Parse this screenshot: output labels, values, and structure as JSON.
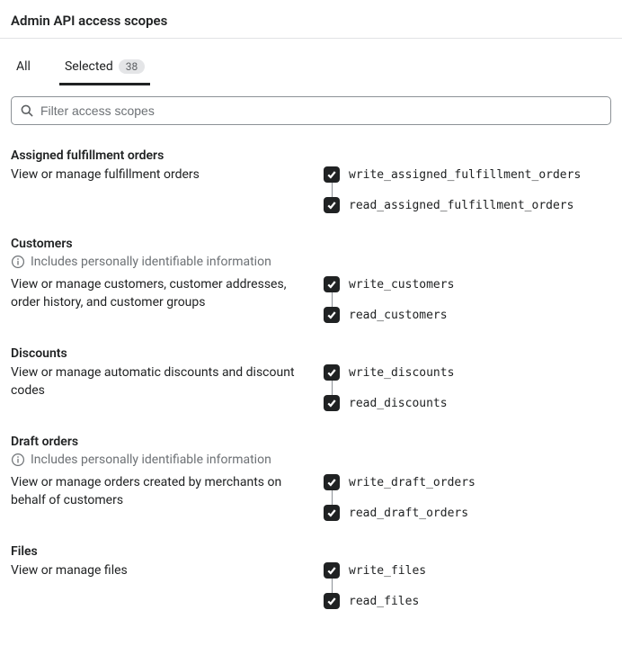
{
  "header": {
    "title": "Admin API access scopes"
  },
  "tabs": [
    {
      "label": "All",
      "active": false
    },
    {
      "label": "Selected",
      "active": true,
      "badge": "38"
    }
  ],
  "search": {
    "placeholder": "Filter access scopes"
  },
  "pii_text": "Includes personally identifiable information",
  "sections": [
    {
      "title": "Assigned fulfillment orders",
      "pii": false,
      "desc": "View or manage fulfillment orders",
      "scopes": [
        {
          "name": "write_assigned_fulfillment_orders",
          "checked": true
        },
        {
          "name": "read_assigned_fulfillment_orders",
          "checked": true
        }
      ]
    },
    {
      "title": "Customers",
      "pii": true,
      "desc": "View or manage customers, customer addresses, order history, and customer groups",
      "scopes": [
        {
          "name": "write_customers",
          "checked": true
        },
        {
          "name": "read_customers",
          "checked": true
        }
      ]
    },
    {
      "title": "Discounts",
      "pii": false,
      "desc": "View or manage automatic discounts and discount codes",
      "scopes": [
        {
          "name": "write_discounts",
          "checked": true
        },
        {
          "name": "read_discounts",
          "checked": true
        }
      ]
    },
    {
      "title": "Draft orders",
      "pii": true,
      "desc": "View or manage orders created by merchants on behalf of customers",
      "scopes": [
        {
          "name": "write_draft_orders",
          "checked": true
        },
        {
          "name": "read_draft_orders",
          "checked": true
        }
      ]
    },
    {
      "title": "Files",
      "pii": false,
      "desc": "View or manage files",
      "scopes": [
        {
          "name": "write_files",
          "checked": true
        },
        {
          "name": "read_files",
          "checked": true
        }
      ]
    }
  ]
}
